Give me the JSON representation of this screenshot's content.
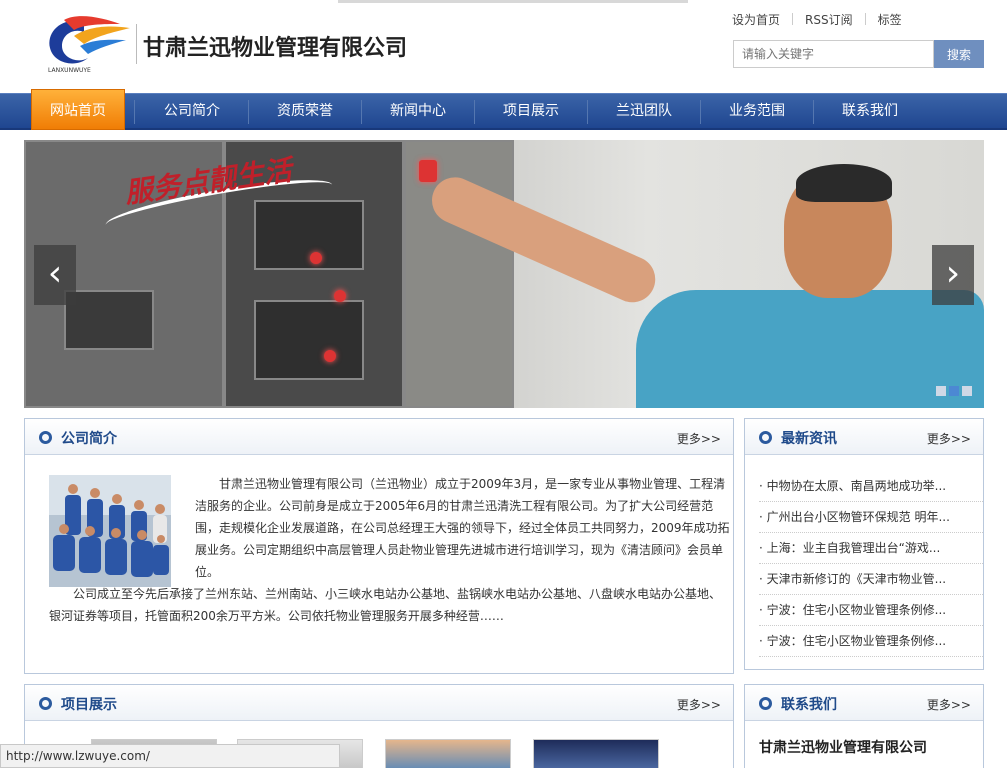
{
  "header": {
    "logo_caption": "LANXUNWUYE",
    "company_name": "甘肃兰迅物业管理有限公司",
    "top_links": [
      "设为首页",
      "RSS订阅",
      "标签"
    ],
    "search_placeholder": "请输入关键字",
    "search_button": "搜索"
  },
  "nav": {
    "items": [
      "网站首页",
      "公司简介",
      "资质荣誉",
      "新闻中心",
      "项目展示",
      "兰迅团队",
      "业务范围",
      "联系我们"
    ],
    "active_index": 0
  },
  "banner": {
    "slogan": "服务点靓生活",
    "prev_arrow": "‹",
    "next_arrow": "›",
    "slide_count": 3,
    "active_slide": 1
  },
  "about": {
    "title": "公司简介",
    "more": "更多>>",
    "paragraph1": "甘肃兰迅物业管理有限公司（兰迅物业）成立于2009年3月，是一家专业从事物业管理、工程清洁服务的企业。公司前身是成立于2005年6月的甘肃兰迅清洗工程有限公司。为了扩大公司经营范围，走规模化企业发展道路，在公司总经理王大强的领导下，经过全体员工共同努力，2009年成功拓展业务。公司定期组织中高层管理人员赴物业管理先进城市进行培训学习，现为《清洁顾问》会员单位。",
    "paragraph2": "公司成立至今先后承接了兰州东站、兰州南站、小三峡水电站办公基地、盐锅峡水电站办公基地、八盘峡水电站办公基地、银河证券等项目，托管面积200余万平方米。公司依托物业管理服务开展多种经营……"
  },
  "news": {
    "title": "最新资讯",
    "more": "更多>>",
    "items": [
      "· 中物协在太原、南昌两地成功举...",
      "· 广州出台小区物管环保规范 明年...",
      "· 上海：业主自我管理出台“游戏...",
      "· 天津市新修订的《天津市物业管...",
      "· 宁波：住宅小区物业管理条例修...",
      "· 宁波：住宅小区物业管理条例修..."
    ]
  },
  "projects": {
    "title": "项目展示",
    "more": "更多>>"
  },
  "contact": {
    "title": "联系我们",
    "more": "更多>>",
    "company": "甘肃兰迅物业管理有限公司"
  },
  "statusbar": {
    "url": "http://www.lzwuye.com/"
  },
  "colors": {
    "nav_blue": "#2a53a0",
    "nav_active_orange": "#f59416",
    "panel_title_blue": "#1f4a8a",
    "search_button": "#6f8fbf"
  }
}
